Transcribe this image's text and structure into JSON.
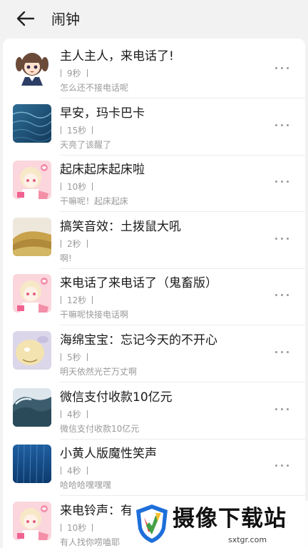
{
  "header": {
    "title": "闹钟"
  },
  "items": [
    {
      "title": "主人主人，来电话了!",
      "duration": "9秒",
      "desc": "怎么还不接电话呢",
      "thumb": "anime-girl"
    },
    {
      "title": "早安，玛卡巴卡",
      "duration": "15秒",
      "desc": "天亮了该醒了",
      "thumb": "blue-water"
    },
    {
      "title": "起床起床起床啦",
      "duration": "10秒",
      "desc": "干嘛呢！起床起床",
      "thumb": "pink-anime"
    },
    {
      "title": "搞笑音效：土拨鼠大吼",
      "duration": "2秒",
      "desc": "啊!",
      "thumb": "hills"
    },
    {
      "title": "来电话了来电话了（鬼畜版）",
      "duration": "12秒",
      "desc": "干嘛呢快接电话啊",
      "thumb": "pink-anime"
    },
    {
      "title": "海绵宝宝：忘记今天的不开心",
      "duration": "5秒",
      "desc": "明天依然光芒万丈啊",
      "thumb": "cartoon"
    },
    {
      "title": "微信支付收款10亿元",
      "duration": "4秒",
      "desc": "微信支付收款10亿元",
      "thumb": "wave"
    },
    {
      "title": "小黄人版魔性笑声",
      "duration": "4秒",
      "desc": "哈哈哈嘿嘿嘿",
      "thumb": "blue-rain"
    },
    {
      "title": "来电铃声：有",
      "duration": "10秒",
      "desc": "有人找你唠嗑耶",
      "thumb": "pink-anime"
    }
  ],
  "watermark": {
    "name": "摄像下载站",
    "url": "sxtgr.com"
  }
}
